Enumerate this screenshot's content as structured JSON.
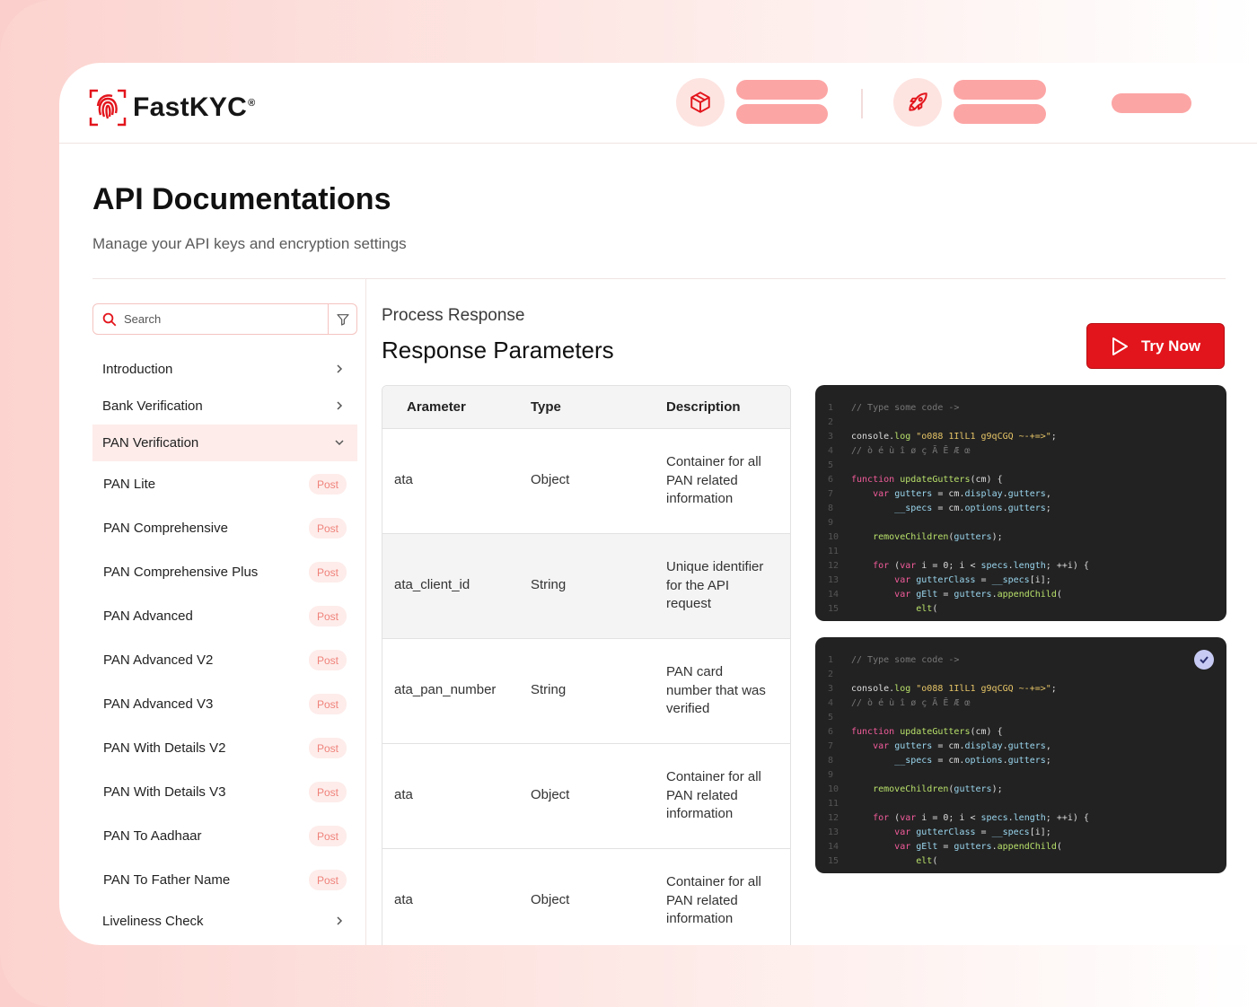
{
  "brand": {
    "name": "FastKYC",
    "reg": "®"
  },
  "page": {
    "title": "API Documentations",
    "subtitle": "Manage your API keys and encryption settings"
  },
  "search": {
    "placeholder": "Search"
  },
  "sidebar": {
    "sections": [
      {
        "label": "Introduction",
        "state": "collapsed"
      },
      {
        "label": "Bank Verification",
        "state": "collapsed"
      },
      {
        "label": "PAN Verification",
        "state": "expanded"
      }
    ],
    "pan_items": [
      {
        "label": "PAN Lite",
        "method": "Post"
      },
      {
        "label": "PAN Comprehensive",
        "method": "Post"
      },
      {
        "label": "PAN Comprehensive Plus",
        "method": "Post"
      },
      {
        "label": "PAN Advanced",
        "method": "Post"
      },
      {
        "label": "PAN Advanced V2",
        "method": "Post"
      },
      {
        "label": "PAN Advanced V3",
        "method": "Post"
      },
      {
        "label": "PAN With Details V2",
        "method": "Post"
      },
      {
        "label": "PAN With Details V3",
        "method": "Post"
      },
      {
        "label": "PAN To Aadhaar",
        "method": "Post"
      },
      {
        "label": "PAN To Father Name",
        "method": "Post"
      }
    ],
    "after": {
      "label": "Liveliness Check",
      "state": "collapsed"
    }
  },
  "content": {
    "label": "Process Response",
    "title": "Response Parameters",
    "try_button": "Try Now"
  },
  "table": {
    "headers": [
      "Arameter",
      "Type",
      "Description"
    ],
    "rows": [
      {
        "param": "ata",
        "type": "Object",
        "desc": [
          "Container for all",
          "PAN related",
          "information"
        ]
      },
      {
        "param": "ata_client_id",
        "type": "String",
        "desc": [
          "Unique identifier",
          "for the API",
          "request"
        ]
      },
      {
        "param": "ata_pan_number",
        "type": "String",
        "desc": [
          "PAN card",
          "number that was",
          "verified"
        ]
      },
      {
        "param": "ata",
        "type": "Object",
        "desc": [
          "Container for all",
          "PAN related",
          "information"
        ]
      },
      {
        "param": "ata",
        "type": "Object",
        "desc": [
          "Container for all",
          "PAN related",
          "information"
        ]
      }
    ]
  },
  "code_lines": [
    "// Type some code ->",
    "",
    "console.log \"o088 1IlL1 g9qCGQ ~-+=>\";",
    "// ò é ù î ø ç Ã Ē Æ œ",
    "",
    "function updateGutters(cm) {",
    "    var gutters = cm.display.gutters,",
    "        __specs = cm.options.gutters;",
    "",
    "    removeChildren(gutters);",
    "",
    "    for (var i = 0; i < specs.length; ++i) {",
    "        var gutterClass = __specs[i];",
    "        var gElt = gutters.appendChild(",
    "            elt("
  ],
  "colors": {
    "accent": "#e3151c",
    "badge_bg": "#fdecea",
    "badge_text": "#f0837b",
    "code_bg": "#222222"
  },
  "icons": {
    "header_1": "box-icon",
    "header_2": "rocket-icon",
    "code_check": "check-icon"
  }
}
